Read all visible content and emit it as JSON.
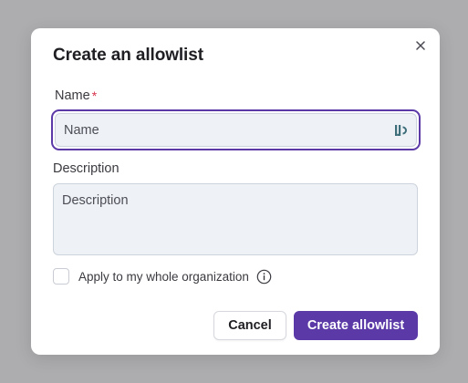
{
  "dialog": {
    "title": "Create an allowlist",
    "close_label": "×"
  },
  "form": {
    "name": {
      "label": "Name",
      "required_mark": "*",
      "placeholder": "Name",
      "value": ""
    },
    "description": {
      "label": "Description",
      "placeholder": "Description",
      "value": ""
    },
    "apply_org": {
      "label": "Apply to my whole organization",
      "checked": false
    }
  },
  "actions": {
    "cancel_label": "Cancel",
    "create_label": "Create allowlist"
  },
  "colors": {
    "primary": "#5b3aa8",
    "required": "#d6334b",
    "input_bg": "#eef2f7",
    "backdrop": "#adadaf"
  },
  "icons": {
    "close": "close-icon",
    "password_manager": "lastpass-icon",
    "info": "info-icon"
  }
}
